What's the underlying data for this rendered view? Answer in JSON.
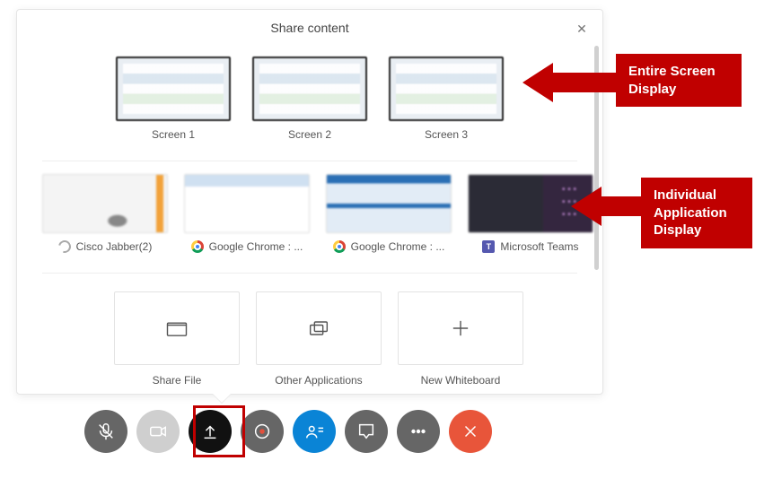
{
  "panel": {
    "title": "Share content",
    "close_symbol": "✕"
  },
  "screens": [
    {
      "label": "Screen 1"
    },
    {
      "label": "Screen 2"
    },
    {
      "label": "Screen 3"
    }
  ],
  "apps": [
    {
      "label": "Cisco Jabber(2)",
      "icon": "jabber"
    },
    {
      "label": "Google Chrome : ...",
      "icon": "chrome"
    },
    {
      "label": "Google Chrome : ...",
      "icon": "chrome"
    },
    {
      "label": "Microsoft Teams",
      "icon": "teams"
    }
  ],
  "actions": {
    "share_file": "Share File",
    "other_apps": "Other Applications",
    "new_whiteboard": "New Whiteboard"
  },
  "toolbar": {
    "mute": "mute-button",
    "video": "video-button",
    "share": "share-button",
    "record": "record-button",
    "participants": "participants-button",
    "chat": "chat-button",
    "more": "more-options-button",
    "end": "end-call-button"
  },
  "callouts": {
    "screen": "Entire Screen Display",
    "app": "Individual Application Display"
  }
}
